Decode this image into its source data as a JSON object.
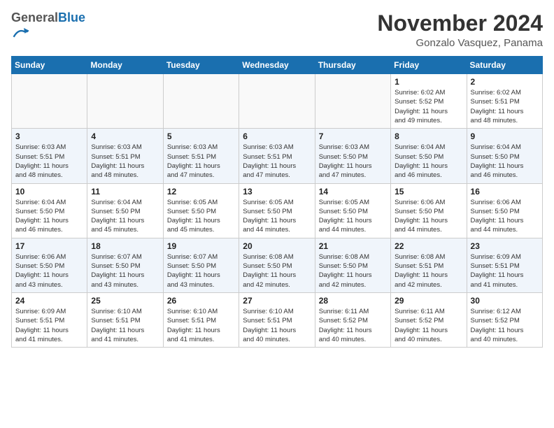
{
  "logo": {
    "general": "General",
    "blue": "Blue"
  },
  "header": {
    "month": "November 2024",
    "subtitle": "Gonzalo Vasquez, Panama"
  },
  "weekdays": [
    "Sunday",
    "Monday",
    "Tuesday",
    "Wednesday",
    "Thursday",
    "Friday",
    "Saturday"
  ],
  "weeks": [
    [
      {
        "day": "",
        "info": ""
      },
      {
        "day": "",
        "info": ""
      },
      {
        "day": "",
        "info": ""
      },
      {
        "day": "",
        "info": ""
      },
      {
        "day": "",
        "info": ""
      },
      {
        "day": "1",
        "info": "Sunrise: 6:02 AM\nSunset: 5:52 PM\nDaylight: 11 hours\nand 49 minutes."
      },
      {
        "day": "2",
        "info": "Sunrise: 6:02 AM\nSunset: 5:51 PM\nDaylight: 11 hours\nand 48 minutes."
      }
    ],
    [
      {
        "day": "3",
        "info": "Sunrise: 6:03 AM\nSunset: 5:51 PM\nDaylight: 11 hours\nand 48 minutes."
      },
      {
        "day": "4",
        "info": "Sunrise: 6:03 AM\nSunset: 5:51 PM\nDaylight: 11 hours\nand 48 minutes."
      },
      {
        "day": "5",
        "info": "Sunrise: 6:03 AM\nSunset: 5:51 PM\nDaylight: 11 hours\nand 47 minutes."
      },
      {
        "day": "6",
        "info": "Sunrise: 6:03 AM\nSunset: 5:51 PM\nDaylight: 11 hours\nand 47 minutes."
      },
      {
        "day": "7",
        "info": "Sunrise: 6:03 AM\nSunset: 5:50 PM\nDaylight: 11 hours\nand 47 minutes."
      },
      {
        "day": "8",
        "info": "Sunrise: 6:04 AM\nSunset: 5:50 PM\nDaylight: 11 hours\nand 46 minutes."
      },
      {
        "day": "9",
        "info": "Sunrise: 6:04 AM\nSunset: 5:50 PM\nDaylight: 11 hours\nand 46 minutes."
      }
    ],
    [
      {
        "day": "10",
        "info": "Sunrise: 6:04 AM\nSunset: 5:50 PM\nDaylight: 11 hours\nand 46 minutes."
      },
      {
        "day": "11",
        "info": "Sunrise: 6:04 AM\nSunset: 5:50 PM\nDaylight: 11 hours\nand 45 minutes."
      },
      {
        "day": "12",
        "info": "Sunrise: 6:05 AM\nSunset: 5:50 PM\nDaylight: 11 hours\nand 45 minutes."
      },
      {
        "day": "13",
        "info": "Sunrise: 6:05 AM\nSunset: 5:50 PM\nDaylight: 11 hours\nand 44 minutes."
      },
      {
        "day": "14",
        "info": "Sunrise: 6:05 AM\nSunset: 5:50 PM\nDaylight: 11 hours\nand 44 minutes."
      },
      {
        "day": "15",
        "info": "Sunrise: 6:06 AM\nSunset: 5:50 PM\nDaylight: 11 hours\nand 44 minutes."
      },
      {
        "day": "16",
        "info": "Sunrise: 6:06 AM\nSunset: 5:50 PM\nDaylight: 11 hours\nand 44 minutes."
      }
    ],
    [
      {
        "day": "17",
        "info": "Sunrise: 6:06 AM\nSunset: 5:50 PM\nDaylight: 11 hours\nand 43 minutes."
      },
      {
        "day": "18",
        "info": "Sunrise: 6:07 AM\nSunset: 5:50 PM\nDaylight: 11 hours\nand 43 minutes."
      },
      {
        "day": "19",
        "info": "Sunrise: 6:07 AM\nSunset: 5:50 PM\nDaylight: 11 hours\nand 43 minutes."
      },
      {
        "day": "20",
        "info": "Sunrise: 6:08 AM\nSunset: 5:50 PM\nDaylight: 11 hours\nand 42 minutes."
      },
      {
        "day": "21",
        "info": "Sunrise: 6:08 AM\nSunset: 5:50 PM\nDaylight: 11 hours\nand 42 minutes."
      },
      {
        "day": "22",
        "info": "Sunrise: 6:08 AM\nSunset: 5:51 PM\nDaylight: 11 hours\nand 42 minutes."
      },
      {
        "day": "23",
        "info": "Sunrise: 6:09 AM\nSunset: 5:51 PM\nDaylight: 11 hours\nand 41 minutes."
      }
    ],
    [
      {
        "day": "24",
        "info": "Sunrise: 6:09 AM\nSunset: 5:51 PM\nDaylight: 11 hours\nand 41 minutes."
      },
      {
        "day": "25",
        "info": "Sunrise: 6:10 AM\nSunset: 5:51 PM\nDaylight: 11 hours\nand 41 minutes."
      },
      {
        "day": "26",
        "info": "Sunrise: 6:10 AM\nSunset: 5:51 PM\nDaylight: 11 hours\nand 41 minutes."
      },
      {
        "day": "27",
        "info": "Sunrise: 6:10 AM\nSunset: 5:51 PM\nDaylight: 11 hours\nand 40 minutes."
      },
      {
        "day": "28",
        "info": "Sunrise: 6:11 AM\nSunset: 5:52 PM\nDaylight: 11 hours\nand 40 minutes."
      },
      {
        "day": "29",
        "info": "Sunrise: 6:11 AM\nSunset: 5:52 PM\nDaylight: 11 hours\nand 40 minutes."
      },
      {
        "day": "30",
        "info": "Sunrise: 6:12 AM\nSunset: 5:52 PM\nDaylight: 11 hours\nand 40 minutes."
      }
    ]
  ]
}
